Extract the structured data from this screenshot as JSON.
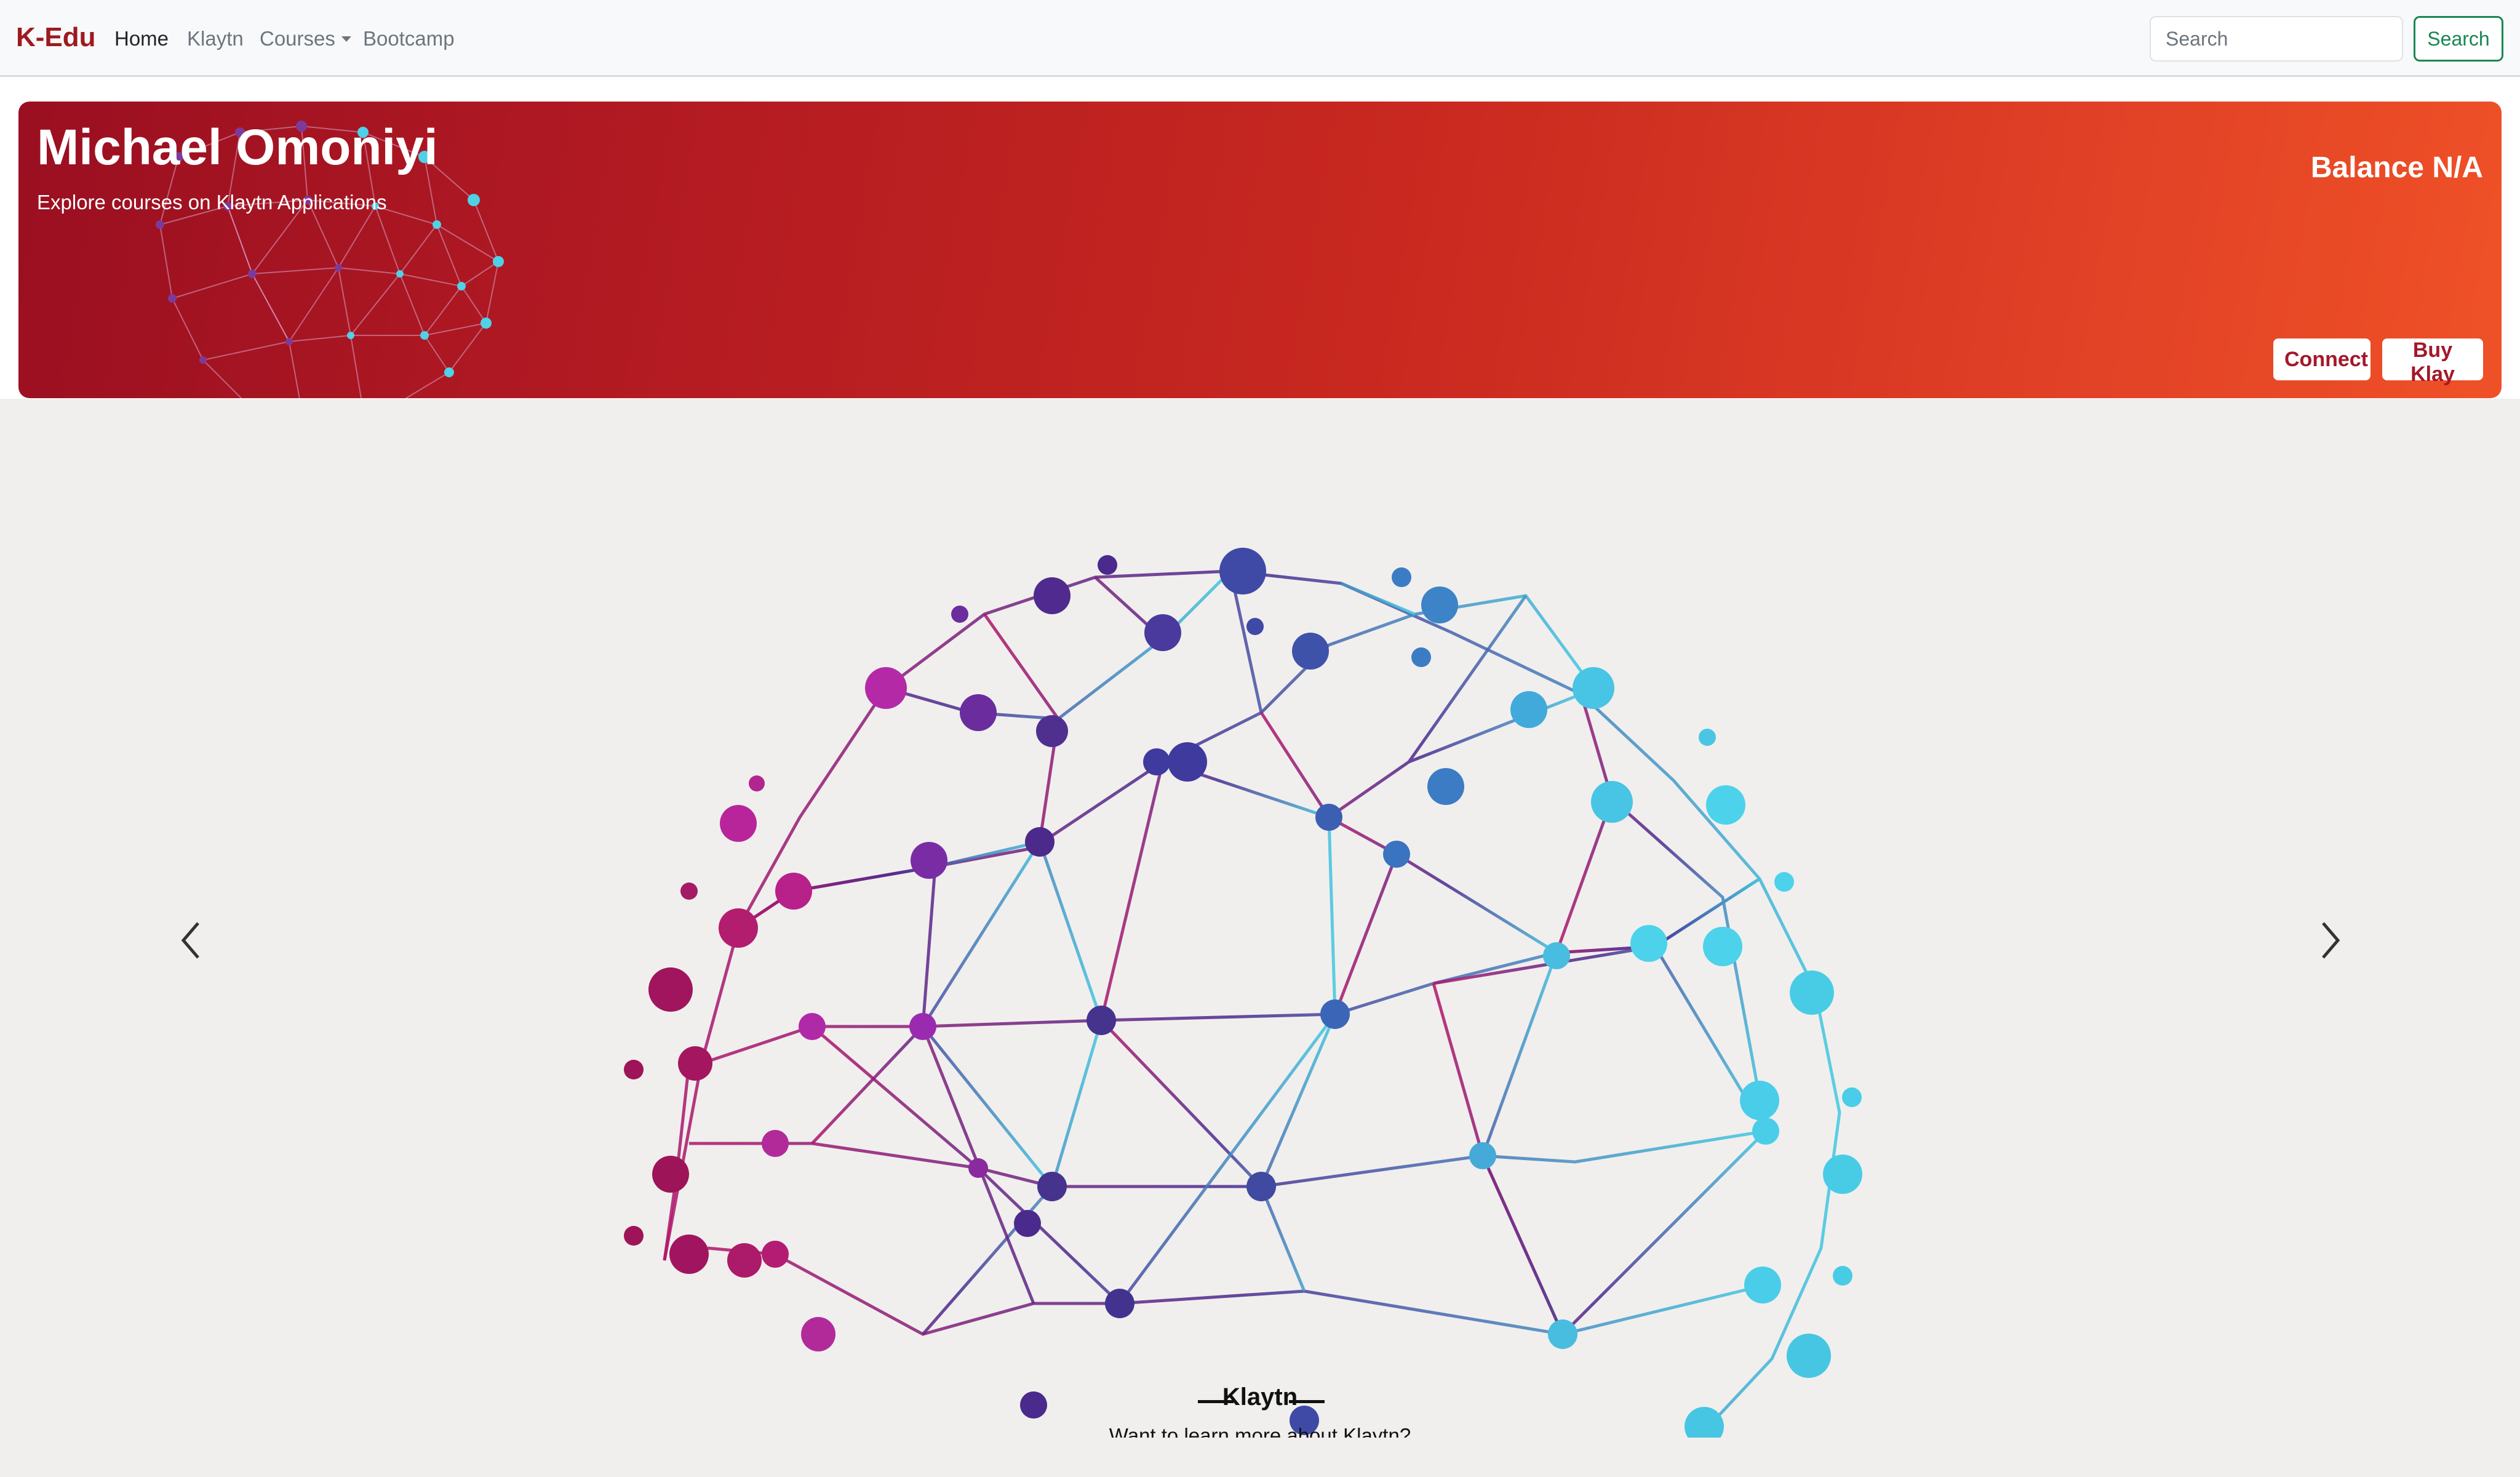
{
  "navbar": {
    "brand": "K-Edu",
    "links": [
      {
        "label": "Home",
        "active": true
      },
      {
        "label": "Klaytn"
      },
      {
        "label": "Courses",
        "dropdown": true
      },
      {
        "label": "Bootcamp"
      }
    ],
    "search_placeholder": "Search",
    "search_button": "Search"
  },
  "hero": {
    "title": "Michael Omoniyi",
    "subtitle": "Explore courses on Klaytn Applications",
    "balance": "Balance N/A",
    "connect_button": "Connect",
    "buy_button": "Buy Klay"
  },
  "carousel": {
    "caption_title": "Klaytn",
    "caption_text": "Want to learn more about Klaytn?",
    "prev_icon": "chevron-left-icon",
    "next_icon": "chevron-right-icon"
  },
  "colors": {
    "brand": "#9e1a1f",
    "hero_start": "#9a0f21",
    "hero_end": "#ef5127",
    "search_button": "#198754",
    "carousel_bg": "#f0efed"
  }
}
